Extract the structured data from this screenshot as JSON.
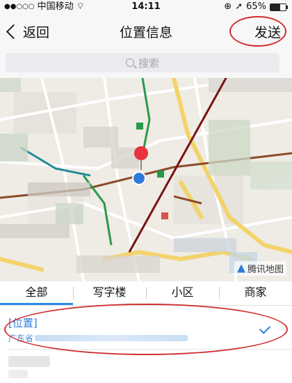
{
  "status_bar": {
    "carrier": "中国移动",
    "time": "14:11",
    "battery": "65%",
    "battery_level": 0.65
  },
  "nav": {
    "back_label": "返回",
    "title": "位置信息",
    "send_label": "发送"
  },
  "search": {
    "placeholder": "搜索"
  },
  "map": {
    "logo_text": "腾讯地图"
  },
  "tabs": [
    {
      "label": "全部",
      "active": true
    },
    {
      "label": "写字楼",
      "active": false
    },
    {
      "label": "小区",
      "active": false
    },
    {
      "label": "商家",
      "active": false
    }
  ],
  "list": {
    "selected": {
      "title": "[位置]",
      "address_prefix": "广东省"
    }
  },
  "colors": {
    "accent": "#2b8ae6",
    "annotation": "#d03030",
    "pin_red": "#e8343b",
    "pin_blue": "#2f7ad6"
  }
}
